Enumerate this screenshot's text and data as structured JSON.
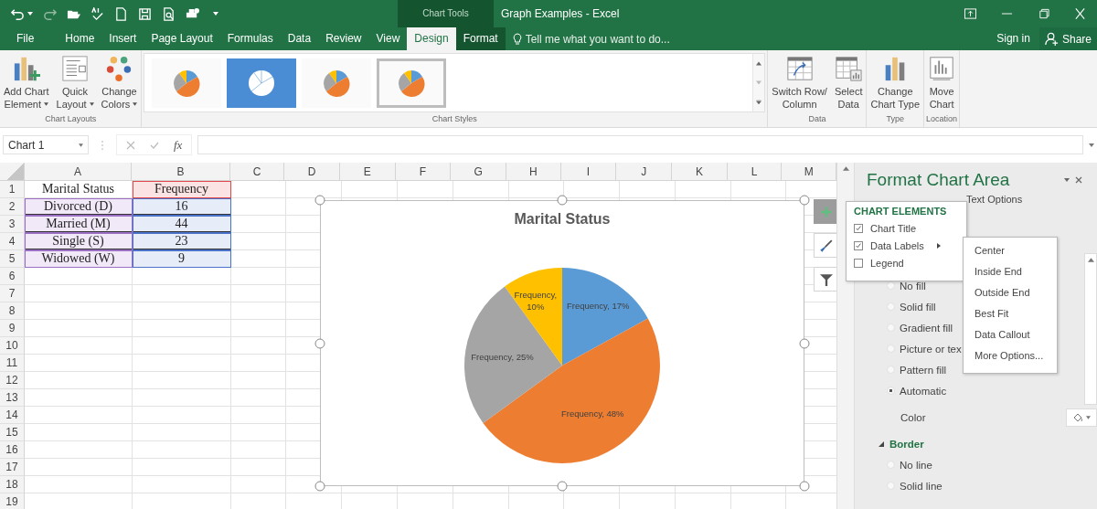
{
  "title_bar": {
    "context_label": "Chart Tools",
    "title": "Graph Examples - Excel"
  },
  "tabs": [
    {
      "label": "File",
      "selected": false,
      "contextual": false
    },
    {
      "label": "Home",
      "selected": false,
      "contextual": false
    },
    {
      "label": "Insert",
      "selected": false,
      "contextual": false
    },
    {
      "label": "Page Layout",
      "selected": false,
      "contextual": false
    },
    {
      "label": "Formulas",
      "selected": false,
      "contextual": false
    },
    {
      "label": "Data",
      "selected": false,
      "contextual": false
    },
    {
      "label": "Review",
      "selected": false,
      "contextual": false
    },
    {
      "label": "View",
      "selected": false,
      "contextual": false
    },
    {
      "label": "Design",
      "selected": true,
      "contextual": true
    },
    {
      "label": "Format",
      "selected": false,
      "contextual": true
    }
  ],
  "tell_me": {
    "placeholder": "Tell me what you want to do..."
  },
  "account": {
    "sign_in": "Sign in",
    "share": "Share"
  },
  "ribbon": {
    "groups": [
      {
        "label": "Chart Layouts",
        "buttons": [
          {
            "lines": [
              "Add Chart",
              "Element"
            ],
            "dropdown": true
          },
          {
            "lines": [
              "Quick",
              "Layout"
            ],
            "dropdown": true
          },
          {
            "lines": [
              "Change",
              "Colors"
            ],
            "dropdown": true
          }
        ]
      },
      {
        "label": "Chart Styles",
        "styles": [
          {
            "selected": false
          },
          {
            "selected": false
          },
          {
            "selected": false
          },
          {
            "selected": true
          }
        ]
      },
      {
        "label": "Data",
        "buttons": [
          {
            "lines": [
              "Switch Row/",
              "Column"
            ]
          },
          {
            "lines": [
              "Select",
              "Data"
            ]
          }
        ]
      },
      {
        "label": "Type",
        "buttons": [
          {
            "lines": [
              "Change",
              "Chart Type"
            ]
          }
        ]
      },
      {
        "label": "Location",
        "buttons": [
          {
            "lines": [
              "Move",
              "Chart"
            ]
          }
        ]
      }
    ]
  },
  "formula_bar": {
    "name_box": "Chart 1",
    "function_label": "fx"
  },
  "sheet": {
    "columns": [
      "A",
      "B",
      "C",
      "D",
      "E",
      "F",
      "G",
      "H",
      "I",
      "J",
      "K",
      "L",
      "M"
    ],
    "rows": [
      "1",
      "2",
      "3",
      "4",
      "5",
      "6",
      "7",
      "8",
      "9",
      "10",
      "11",
      "12",
      "13",
      "14",
      "15",
      "16",
      "17",
      "18",
      "19"
    ],
    "cells": [
      [
        "Marital Status",
        "Frequency"
      ],
      [
        "Divorced (D)",
        "16"
      ],
      [
        "Married (M)",
        "44"
      ],
      [
        "Single (S)",
        "23"
      ],
      [
        "Widowed (W)",
        "9"
      ]
    ]
  },
  "chart": {
    "chart_data": {
      "type": "pie",
      "title": "Marital Status",
      "colors": [
        "#5b9bd5",
        "#ed7d31",
        "#a5a5a5",
        "#ffc000"
      ],
      "values": [
        17,
        48,
        25,
        10
      ],
      "data_labels": true,
      "value_labels": [
        "Frequency, 17%",
        "Frequency, 48%",
        "Frequency, 25%",
        "Frequency, 10%"
      ]
    },
    "side_buttons": [
      {
        "selected": true
      },
      {
        "selected": false
      },
      {
        "selected": false
      }
    ]
  },
  "chart_elements": {
    "title": "CHART ELEMENTS",
    "items": [
      {
        "label": "Chart Title",
        "checked": true,
        "submenu": false
      },
      {
        "label": "Data Labels",
        "checked": true,
        "submenu": true
      },
      {
        "label": "Legend",
        "checked": false,
        "submenu": false
      }
    ]
  },
  "data_labels_menu": {
    "items": [
      "Center",
      "Inside End",
      "Outside End",
      "Best Fit",
      "Data Callout",
      "More Options..."
    ]
  },
  "panel": {
    "title": "Format Chart Area",
    "text_options_tab": "Text Options",
    "fill_options": [
      {
        "label": "No fill",
        "selected": false
      },
      {
        "label": "Solid fill",
        "selected": false
      },
      {
        "label": "Gradient fill",
        "selected": false
      },
      {
        "label": "Picture or tex",
        "selected": false
      },
      {
        "label": "Pattern fill",
        "selected": false
      },
      {
        "label": "Automatic",
        "selected": true
      }
    ],
    "color_label": "Color",
    "border": {
      "label": "Border",
      "expanded": true,
      "options": [
        {
          "label": "No line",
          "selected": false
        },
        {
          "label": "Solid line",
          "selected": false
        }
      ]
    }
  }
}
